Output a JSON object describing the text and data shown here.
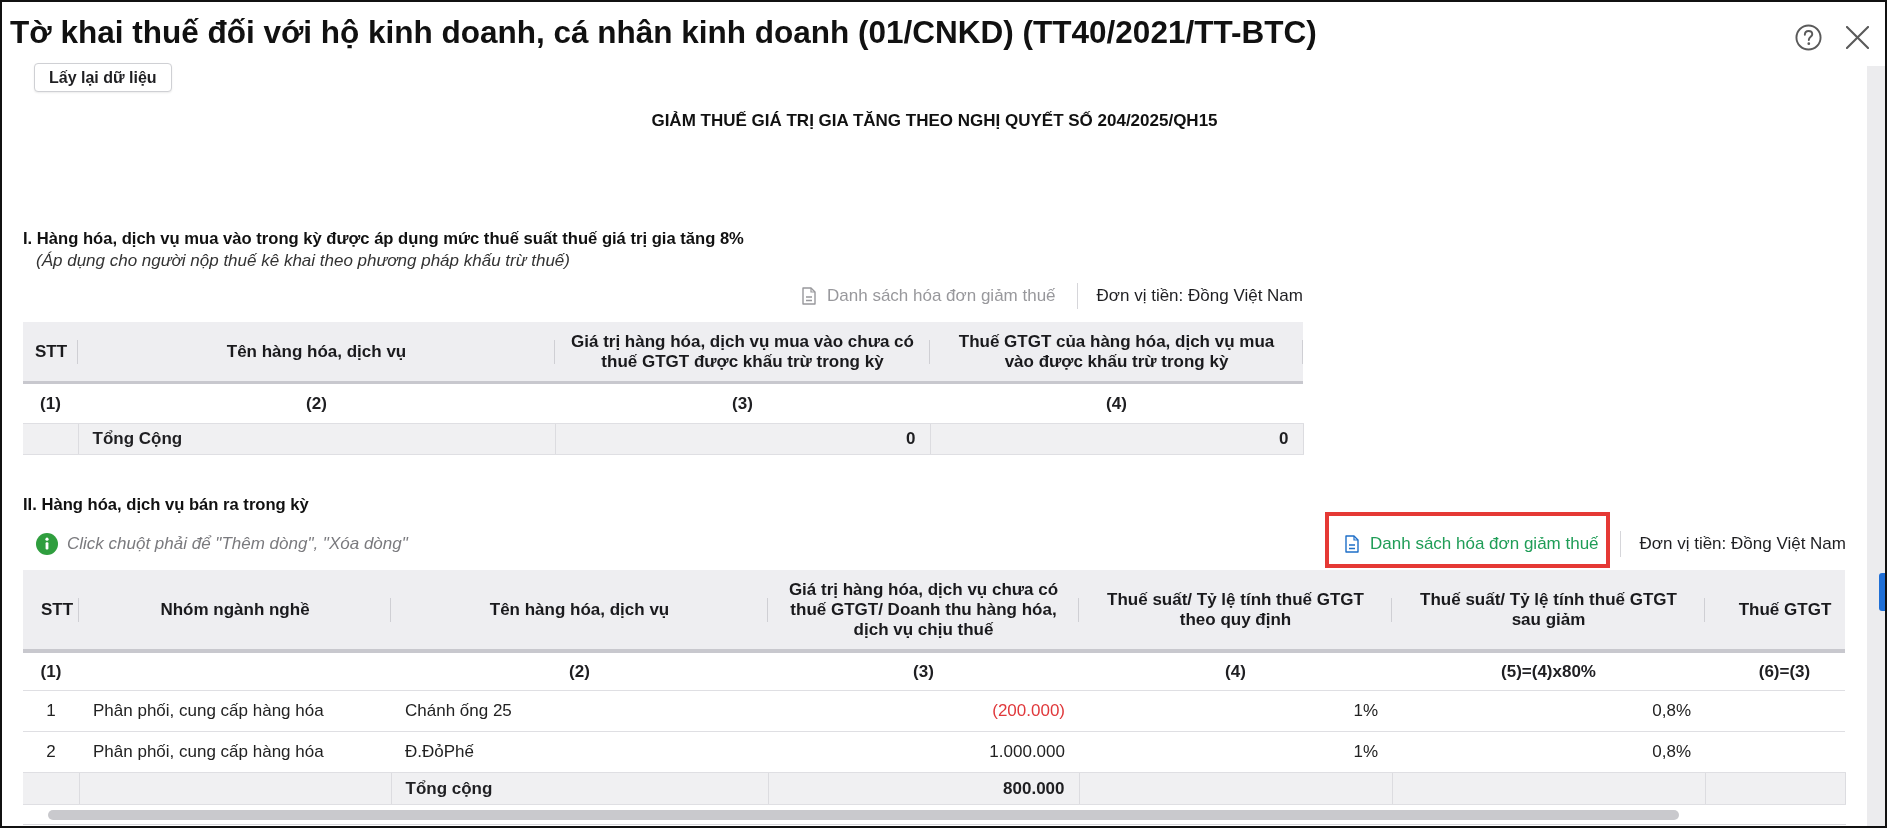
{
  "window": {
    "title": "Tờ khai thuế đối với hộ kinh doanh, cá nhân kinh doanh (01/CNKD) (TT40/2021/TT-BTC)"
  },
  "refresh_button": {
    "label": "Lấy lại dữ liệu"
  },
  "heading": "GIẢM THUẾ GIÁ TRỊ GIA TĂNG THEO NGHỊ QUYẾT SỐ 204/2025/QH15",
  "purchases_section": {
    "title": "I. Hàng hóa, dịch vụ mua vào trong kỳ được áp dụng mức thuế suất thuế giá trị gia tăng 8%",
    "note": "(Áp dụng cho người nộp thuế kê khai theo phương pháp khấu trừ thuế)",
    "invoice_link": {
      "label": "Danh sách hóa đơn giảm thuế",
      "disabled": true
    },
    "currency": "Đơn vị tiền: Đồng Việt Nam",
    "table": {
      "columns": [
        {
          "header": "STT",
          "index": "(1)"
        },
        {
          "header": "Tên hàng hóa, dịch vụ",
          "index": "(2)"
        },
        {
          "header": "Giá trị hàng hóa, dịch vụ mua vào chưa có thuế GTGT được khấu trừ trong kỳ",
          "index": "(3)"
        },
        {
          "header": "Thuế GTGT của hàng hóa, dịch vụ mua vào được khấu trừ trong kỳ",
          "index": "(4)"
        }
      ],
      "total_row": {
        "label": "Tổng Cộng",
        "values": [
          "0",
          "0"
        ]
      }
    }
  },
  "sales_section": {
    "title": "II. Hàng hóa, dịch vụ bán ra trong kỳ",
    "hint": "Click chuột phải để \"Thêm dòng\", \"Xóa dòng\"",
    "invoice_link": {
      "label": "Danh sách hóa đơn giảm thuế",
      "disabled": false,
      "highlighted": true
    },
    "currency": "Đơn vị tiền: Đồng Việt Nam",
    "table": {
      "columns": [
        {
          "header": "STT",
          "index": "(1)"
        },
        {
          "header": "Nhóm ngành nghề"
        },
        {
          "header": "Tên hàng hóa, dịch vụ",
          "index": "(2)"
        },
        {
          "header": "Giá trị hàng hóa, dịch vụ chưa có thuế GTGT/ Doanh thu hàng hóa, dịch vụ chịu thuế",
          "index": "(3)"
        },
        {
          "header": "Thuế suất/ Tỷ lệ tính thuế GTGT theo quy định",
          "index": "(4)"
        },
        {
          "header": "Thuế suất/ Tỷ lệ tính thuế GTGT sau giảm",
          "index": "(5)=(4)x80%"
        },
        {
          "header": "Thuế GTGT",
          "index": "(6)=(3)"
        }
      ],
      "rows": [
        {
          "stt": "1",
          "industry_group": "Phân phối, cung cấp hàng hóa",
          "item_name": "Chánh ống 25",
          "value": "(200.000)",
          "value_negative": true,
          "rate": "1%",
          "reduced_rate": "0,8%"
        },
        {
          "stt": "2",
          "industry_group": "Phân phối, cung cấp hàng hóa",
          "item_name": "Đ.ĐỏPhế",
          "value": "1.000.000",
          "value_negative": false,
          "rate": "1%",
          "reduced_rate": "0,8%"
        }
      ],
      "total_row": {
        "label": "Tổng cộng",
        "values": [
          "800.000"
        ]
      }
    }
  }
}
